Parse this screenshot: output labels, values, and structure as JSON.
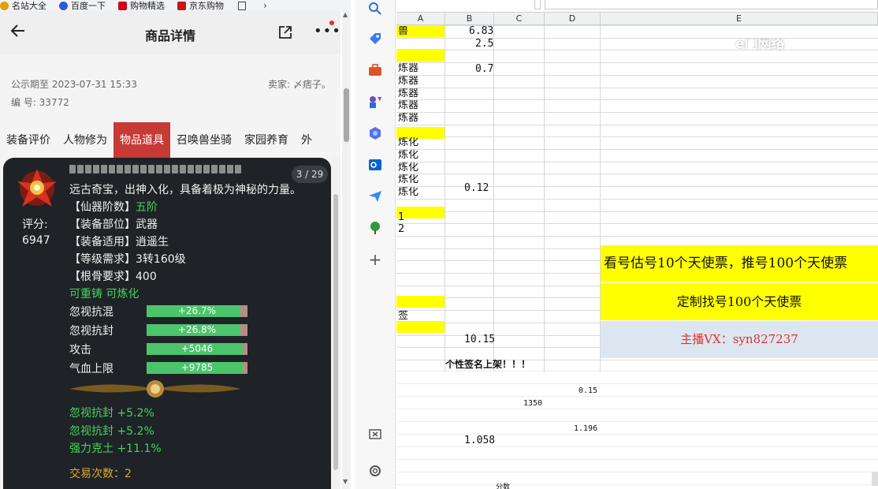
{
  "browser": {
    "bookmarks": [
      {
        "label": "名站大全",
        "icon": "favicon-icon",
        "color": "#e0a000"
      },
      {
        "label": "百度一下",
        "icon": "baidu-icon",
        "color": "#2a5bd7"
      },
      {
        "label": "购物精选",
        "icon": "shopping-icon",
        "color": "#d0021b"
      },
      {
        "label": "京东购物",
        "icon": "jd-icon",
        "color": "#c9151e"
      }
    ]
  },
  "listing": {
    "title": "商品详情",
    "public_until": "公示期至 2023-07-31 15:33",
    "seller": "卖家: 〆痞子。",
    "serial": "编 号: 33772",
    "tabs": [
      "装备评价",
      "人物修为",
      "物品道具",
      "召唤兽坐骑",
      "家园养育",
      "外"
    ],
    "active_tab": 2
  },
  "item": {
    "pager": "3 / 29",
    "description": "远古奇宝，出神入化，具备着极为神秘的力量。",
    "score_label": "评分:",
    "score_value": "6947",
    "attributes": [
      {
        "key": "【仙器阶数】",
        "value": "五阶",
        "green": true
      },
      {
        "key": "【装备部位】",
        "value": "武器",
        "green": false
      },
      {
        "key": "【装备适用】",
        "value": "逍遥生",
        "green": false
      },
      {
        "key": "【等级需求】",
        "value": "3转160级",
        "green": false
      },
      {
        "key": "【根骨要求】",
        "value": "400",
        "green": false
      }
    ],
    "flags": "可重铸 可炼化",
    "bars": [
      {
        "label": "忽视抗混",
        "value": "+26.7%",
        "fill": 0.93
      },
      {
        "label": "忽视抗封",
        "value": "+26.8%",
        "fill": 0.93
      },
      {
        "label": "攻击",
        "value": "+5046",
        "fill": 0.95
      },
      {
        "label": "气血上限",
        "value": "+9785",
        "fill": 0.95
      }
    ],
    "bonuses": [
      "忽视抗封 +5.2%",
      "忽视抗封 +5.2%",
      "强力克土 +11.1%"
    ],
    "trade_count": "交易次数：2"
  },
  "sheet": {
    "columns": [
      "A",
      "B",
      "C",
      "D",
      "E"
    ],
    "col_a": [
      "兽",
      "",
      "",
      "炼器",
      "炼器",
      "炼器",
      "炼器",
      "炼器",
      "",
      "炼化",
      "炼化",
      "炼化",
      "炼化",
      "炼化",
      "",
      "1",
      "2",
      "",
      "",
      "",
      "",
      "",
      "",
      "签",
      "",
      "",
      ""
    ],
    "col_b": {
      "r1": "6.83",
      "r2": "2.5",
      "r4": "0.7",
      "r14": "0.12",
      "r26": "10.15"
    },
    "note_row": "个性签名上架！！！",
    "lower": {
      "d1": "0.15",
      "c1": "1350",
      "d2": "1.196",
      "b1": "1.058",
      "c_bottom": "分数"
    },
    "banner1": "看号估号10个天使票，推号100个天使票",
    "banner2": "定制找号100个天使票",
    "banner3": "主播VX：syn827237",
    "watermark": "e门网络"
  },
  "colors": {
    "accent_red": "#c73a36",
    "green": "#42d65b",
    "gold": "#e0a92a",
    "yellow_cell": "#ffff00",
    "blue_cell": "#dce6f0",
    "vx_red": "#e0322d"
  }
}
